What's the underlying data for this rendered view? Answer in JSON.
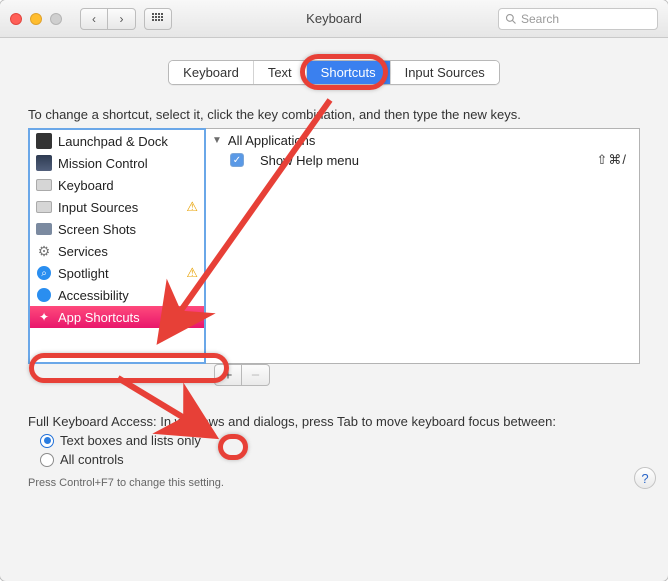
{
  "titlebar": {
    "title": "Keyboard",
    "search_placeholder": "Search"
  },
  "tabs": [
    "Keyboard",
    "Text",
    "Shortcuts",
    "Input Sources"
  ],
  "selected_tab_index": 2,
  "instructions": "To change a shortcut, select it, click the key combination, and then type the new keys.",
  "categories": [
    {
      "label": "Launchpad & Dock",
      "icon": "launchpad-icon",
      "warning": false
    },
    {
      "label": "Mission Control",
      "icon": "mission-control-icon",
      "warning": false
    },
    {
      "label": "Keyboard",
      "icon": "keyboard-icon",
      "warning": false
    },
    {
      "label": "Input Sources",
      "icon": "input-sources-icon",
      "warning": true
    },
    {
      "label": "Screen Shots",
      "icon": "screenshot-icon",
      "warning": false
    },
    {
      "label": "Services",
      "icon": "services-icon",
      "warning": false
    },
    {
      "label": "Spotlight",
      "icon": "spotlight-icon",
      "warning": true
    },
    {
      "label": "Accessibility",
      "icon": "accessibility-icon",
      "warning": false
    },
    {
      "label": "App Shortcuts",
      "icon": "app-shortcuts-icon",
      "warning": false
    }
  ],
  "selected_category_index": 8,
  "right_panel": {
    "group": "All Applications",
    "items": [
      {
        "label": "Show Help menu",
        "checked": true,
        "shortcut": "⇧⌘/"
      }
    ]
  },
  "footer_buttons": {
    "add": "+",
    "remove": "−"
  },
  "fka": {
    "intro": "Full Keyboard Access: In windows and dialogs, press Tab to move keyboard focus between:",
    "options": [
      "Text boxes and lists only",
      "All controls"
    ],
    "selected": 0,
    "hint": "Press Control+F7 to change this setting."
  },
  "help_label": "?"
}
